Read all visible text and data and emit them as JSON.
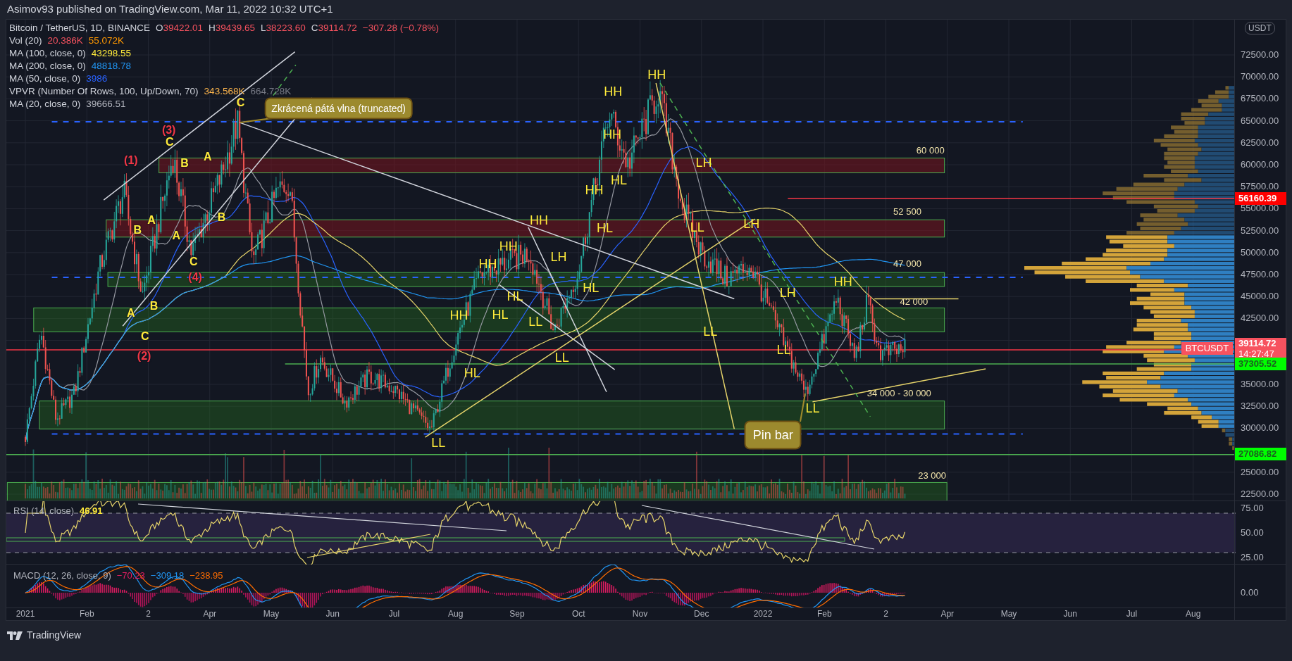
{
  "header": {
    "text": "Asimov93 published on TradingView.com, Mar 11, 2022 10:32 UTC+1"
  },
  "legend": {
    "symbol": "Bitcoin / TetherUS, 1D, BINANCE",
    "ohlc": [
      {
        "letter": "O",
        "value": "39422.01"
      },
      {
        "letter": "H",
        "value": "39439.65"
      },
      {
        "letter": "L",
        "value": "38223.60"
      },
      {
        "letter": "C",
        "value": "39114.72"
      }
    ],
    "change": "−307.28 (−0.78%)",
    "indicators": [
      {
        "name": "Vol (20)",
        "values": [
          {
            "text": "20.386K",
            "color": "#f7525f"
          },
          {
            "text": "55.072K",
            "color": "#ff9800"
          }
        ]
      },
      {
        "name": "MA (100, close, 0)",
        "values": [
          {
            "text": "43298.55",
            "color": "#ffeb3b"
          }
        ]
      },
      {
        "name": "MA (200, close, 0)",
        "values": [
          {
            "text": "48818.78",
            "color": "#2196f3"
          }
        ]
      },
      {
        "name": "MA (50, close, 0)",
        "values": [
          {
            "text": "3986",
            "color": "#2962ff"
          }
        ]
      },
      {
        "name": "VPVR (Number Of Rows, 100, Up/Down, 70)",
        "values": [
          {
            "text": "343.568K",
            "color": "#ffb74d"
          },
          {
            "text": "664.728K",
            "color": "#787b86"
          }
        ]
      },
      {
        "name": "MA (20, close, 0)",
        "values": [
          {
            "text": "39666.51",
            "color": "#b2b5be"
          }
        ]
      }
    ]
  },
  "price_axis": {
    "currency": "USDT",
    "labels": [
      "72500.00",
      "70000.00",
      "67500.00",
      "65000.00",
      "62500.00",
      "60000.00",
      "57500.00",
      "55000.00",
      "52500.00",
      "50000.00",
      "47500.00",
      "45000.00",
      "42500.00",
      "35000.00",
      "32500.00",
      "30000.00",
      "25000.00",
      "22500.00"
    ]
  },
  "price_tags": [
    {
      "kind": "level",
      "price": "56160.39",
      "color": "#ff0000"
    },
    {
      "kind": "last",
      "symbol": "BTCUSDT",
      "price": "39114.72",
      "countdown": "14:27:47",
      "color": "#f7525f"
    },
    {
      "kind": "level",
      "price": "37305.52",
      "color": "#00ff00"
    },
    {
      "kind": "level",
      "price": "27086.82",
      "color": "#00ff00"
    }
  ],
  "zone_labels": [
    "60 000",
    "52 500",
    "47 000",
    "42 000",
    "34 000 - 30 000",
    "23 000"
  ],
  "structure_labels": [
    "HH",
    "HH",
    "HH",
    "HL",
    "HH",
    "HL",
    "HH",
    "HH",
    "HH",
    "LH",
    "HL",
    "HL",
    "HH",
    "HL",
    "LL",
    "LL",
    "HL",
    "LL",
    "LH",
    "LL",
    "LH",
    "LL",
    "LH",
    "HH",
    "LL",
    "LL"
  ],
  "wave_labels": [
    {
      "text": "(1)",
      "color": "#f23645"
    },
    {
      "text": "(3)",
      "color": "#f23645"
    },
    {
      "text": "C",
      "color": "#ffeb3b"
    },
    {
      "text": "B",
      "color": "#ffeb3b"
    },
    {
      "text": "A",
      "color": "#ffeb3b"
    },
    {
      "text": "C",
      "color": "#ffeb3b"
    },
    {
      "text": "A",
      "color": "#ffeb3b"
    },
    {
      "text": "B",
      "color": "#ffeb3b"
    },
    {
      "text": "A",
      "color": "#ffeb3b"
    },
    {
      "text": "B",
      "color": "#ffeb3b"
    },
    {
      "text": "C",
      "color": "#ffeb3b"
    },
    {
      "text": "(4)",
      "color": "#f23645"
    },
    {
      "text": "A",
      "color": "#ffeb3b"
    },
    {
      "text": "B",
      "color": "#ffeb3b"
    },
    {
      "text": "C",
      "color": "#ffeb3b"
    },
    {
      "text": "(2)",
      "color": "#f23645"
    }
  ],
  "callouts": [
    "Zkrácená pátá vlna (truncated)",
    "Pin bar"
  ],
  "rsi": {
    "legend": "RSI (14, close)",
    "value": "46.91",
    "axis": [
      "75.00",
      "50.00",
      "25.00"
    ]
  },
  "macd": {
    "legend": "MACD (12, 26, close, 9)",
    "values": [
      {
        "text": "−70.23",
        "color": "#e91e63"
      },
      {
        "text": "−309.18",
        "color": "#2196f3"
      },
      {
        "text": "−238.95",
        "color": "#ff6d00"
      }
    ],
    "axis": [
      "0.00"
    ]
  },
  "time_axis": [
    "2021",
    "Feb",
    "2",
    "Apr",
    "May",
    "Jun",
    "Jul",
    "Aug",
    "Sep",
    "Oct",
    "Nov",
    "Dec",
    "2022",
    "Feb",
    "2",
    "Apr",
    "May",
    "Jun",
    "Jul",
    "Aug"
  ],
  "footer": {
    "brand": "TradingView"
  }
}
